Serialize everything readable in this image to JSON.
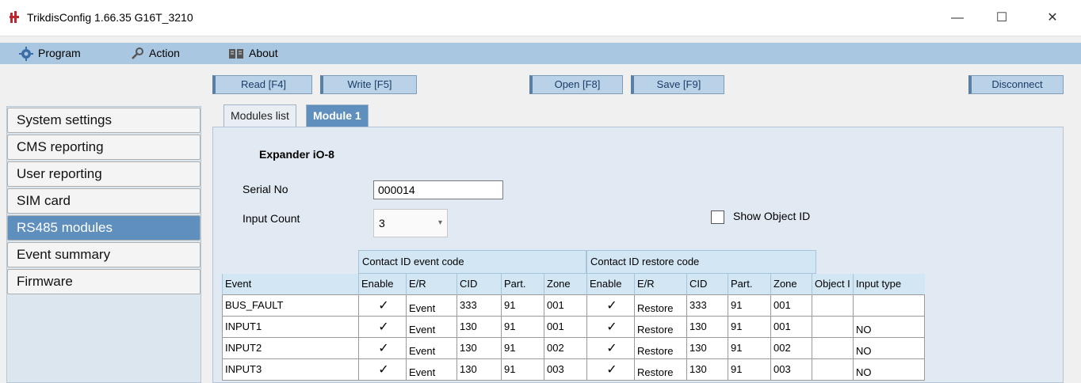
{
  "window": {
    "title": "TrikdisConfig 1.66.35   G16T_3210",
    "controls": {
      "minimize": "—",
      "maximize": "☐",
      "close": "✕"
    }
  },
  "menu": {
    "items": [
      {
        "label": "Program",
        "icon": "gear-icon"
      },
      {
        "label": "Action",
        "icon": "wrench-icon"
      },
      {
        "label": "About",
        "icon": "book-icon"
      }
    ]
  },
  "toolbar": {
    "read": "Read [F4]",
    "write": "Write [F5]",
    "open": "Open [F8]",
    "save": "Save [F9]",
    "disconnect": "Disconnect"
  },
  "sidebar": {
    "items": [
      {
        "label": "System settings",
        "active": false
      },
      {
        "label": "CMS reporting",
        "active": false
      },
      {
        "label": "User reporting",
        "active": false
      },
      {
        "label": "SIM card",
        "active": false
      },
      {
        "label": "RS485 modules",
        "active": true
      },
      {
        "label": "Event summary",
        "active": false
      },
      {
        "label": "Firmware",
        "active": false
      }
    ]
  },
  "tabs": [
    {
      "label": "Modules list",
      "active": false
    },
    {
      "label": "Module 1",
      "active": true
    }
  ],
  "module": {
    "heading": "Expander iO-8",
    "serial_label": "Serial No",
    "serial_value": "000014",
    "input_count_label": "Input Count",
    "input_count_value": "3",
    "show_object_id_label": "Show Object ID",
    "show_object_id_checked": false
  },
  "table": {
    "group_headers": [
      "Contact ID event code",
      "Contact ID restore code"
    ],
    "columns": [
      "Event",
      "Enable",
      "E/R",
      "CID",
      "Part.",
      "Zone",
      "Enable",
      "E/R",
      "CID",
      "Part.",
      "Zone",
      "Object I",
      "Input type"
    ],
    "rows": [
      {
        "event": "BUS_FAULT",
        "enable": "✓",
        "er": "Event",
        "cid": "333",
        "part": "91",
        "zone": "001",
        "r_enable": "✓",
        "r_er": "Restore",
        "r_cid": "333",
        "r_part": "91",
        "r_zone": "001",
        "object": "",
        "input_type": ""
      },
      {
        "event": "INPUT1",
        "enable": "✓",
        "er": "Event",
        "cid": "130",
        "part": "91",
        "zone": "001",
        "r_enable": "✓",
        "r_er": "Restore",
        "r_cid": "130",
        "r_part": "91",
        "r_zone": "001",
        "object": "",
        "input_type": "NO"
      },
      {
        "event": "INPUT2",
        "enable": "✓",
        "er": "Event",
        "cid": "130",
        "part": "91",
        "zone": "002",
        "r_enable": "✓",
        "r_er": "Restore",
        "r_cid": "130",
        "r_part": "91",
        "r_zone": "002",
        "object": "",
        "input_type": "NO"
      },
      {
        "event": "INPUT3",
        "enable": "✓",
        "er": "Event",
        "cid": "130",
        "part": "91",
        "zone": "003",
        "r_enable": "✓",
        "r_er": "Restore",
        "r_cid": "130",
        "r_part": "91",
        "r_zone": "003",
        "object": "",
        "input_type": "NO"
      }
    ]
  },
  "colors": {
    "menubar": "#a9c7e0",
    "active_accent": "#5f8fbd",
    "panel_bg": "#e1eaf2",
    "header_bg": "#d3e6f4"
  }
}
